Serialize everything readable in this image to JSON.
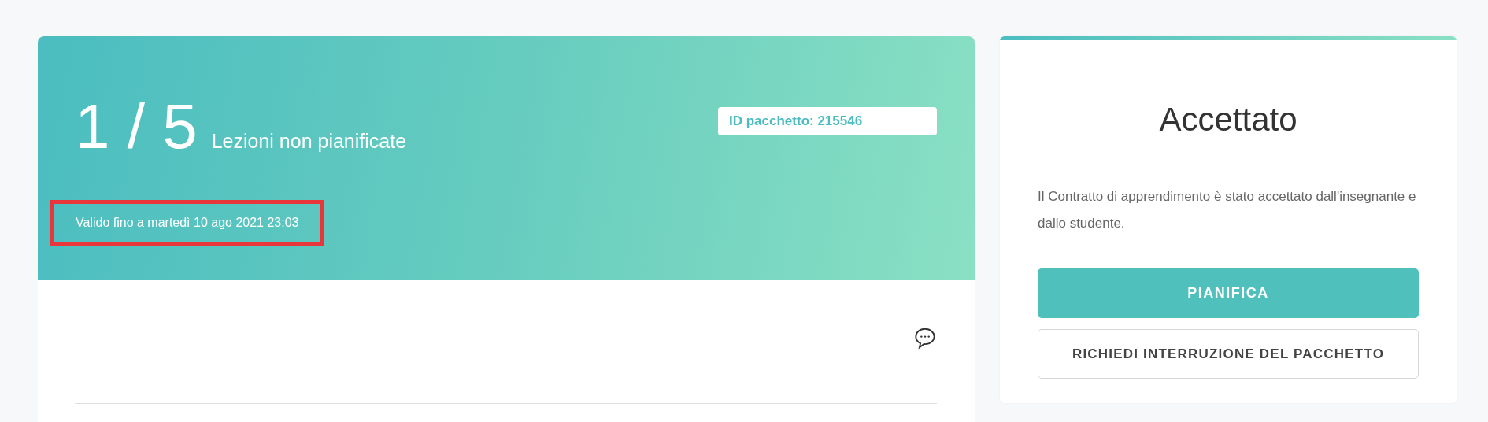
{
  "package": {
    "count": "1 / 5",
    "count_label": "Lezioni non pianificate",
    "id_badge": "ID pacchetto: 215546",
    "validity": {
      "text": "Valido fino a martedì 10 ago 2021 23:03",
      "highlighted": true
    }
  },
  "status_card": {
    "title": "Accettato",
    "description": "Il Contratto di apprendimento è stato accettato dall'insegnante e dallo studente.",
    "buttons": [
      {
        "label": "PIANIFICA",
        "kind": "primary"
      },
      {
        "label": "RICHIEDI INTERRUZIONE DEL PACCHETTO",
        "kind": "outline"
      }
    ]
  }
}
